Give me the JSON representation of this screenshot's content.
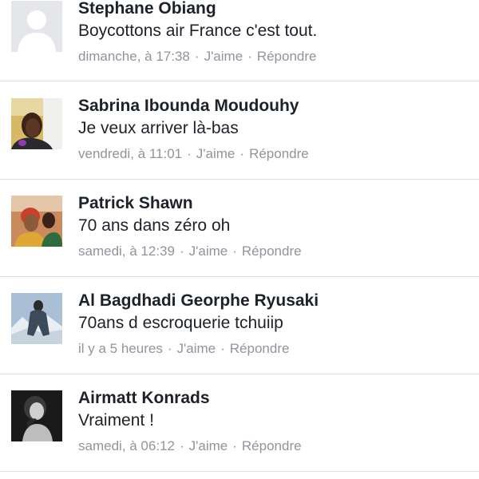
{
  "comments": [
    {
      "name": "Stephane Obiang",
      "text": "Boycottons air France c'est tout.",
      "time": "dimanche, à 17:38",
      "like": "J'aime",
      "reply": "Répondre",
      "avatar": "default-silhouette"
    },
    {
      "name": "Sabrina Ibounda Moudouhy",
      "text": "Je veux arriver là-bas",
      "time": "vendredi, à 11:01",
      "like": "J'aime",
      "reply": "Répondre",
      "avatar": "woman-selfie-photo"
    },
    {
      "name": "Patrick Shawn",
      "text": "70 ans dans zéro oh",
      "time": "samedi, à 12:39",
      "like": "J'aime",
      "reply": "Répondre",
      "avatar": "couple-photo"
    },
    {
      "name": "Al Bagdhadi Georphe Ryusaki",
      "text": "70ans d escroquerie tchuiip",
      "time": "il y a 5 heures",
      "like": "J'aime",
      "reply": "Répondre",
      "avatar": "mountain-photo"
    },
    {
      "name": "Airmatt Konrads",
      "text": "Vraiment !",
      "time": "samedi, à 06:12",
      "like": "J'aime",
      "reply": "Répondre",
      "avatar": "bw-portrait-photo"
    }
  ],
  "separator": "·",
  "colors": {
    "name": "#1d2129",
    "meta": "#90949c",
    "divider": "#dcdde0"
  }
}
